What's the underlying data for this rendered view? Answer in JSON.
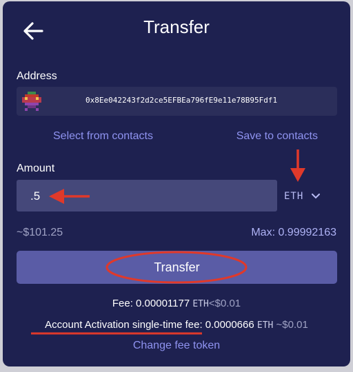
{
  "header": {
    "title": "Transfer",
    "back_icon": "arrow-left-icon"
  },
  "address": {
    "label": "Address",
    "value": "0x8Ee042243f2d2ce5EFBEa796fE9e11e78B95Fdf1",
    "avatar_icon": "pixel-avatar-icon"
  },
  "contacts": {
    "select_label": "Select from contacts",
    "save_label": "Save to contacts"
  },
  "amount": {
    "label": "Amount",
    "value": ".5",
    "token": "ETH",
    "usd_estimate": "~$101.25",
    "max_label": "Max: 0.99992163"
  },
  "actions": {
    "transfer_label": "Transfer"
  },
  "fees": {
    "fee_label": "Fee: 0.00001177",
    "fee_token": "ETH",
    "fee_usd": "<$0.01",
    "activation_label": "Account Activation single-time fee:",
    "activation_value": "0.0000666",
    "activation_token": "ETH",
    "activation_usd": "~$0.01",
    "change_token_label": "Change fee token"
  },
  "annotation_color": "#e0392a",
  "colors": {
    "panel_bg": "#1e2150",
    "input_bg": "#2b2e5a",
    "amount_bg": "#45487a",
    "button_bg": "#5a5ca6",
    "link": "#8f93f0"
  }
}
